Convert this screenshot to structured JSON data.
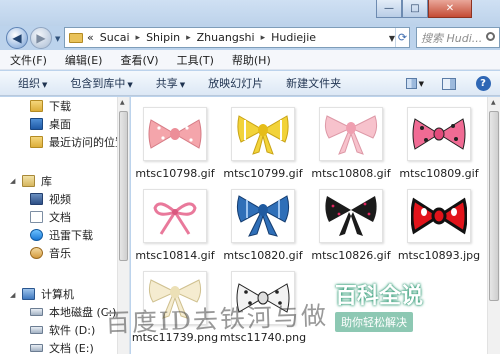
{
  "window": {
    "minimize_label": "—",
    "maximize_label": "□",
    "close_label": "✕"
  },
  "address": {
    "prefix": "«",
    "crumbs": [
      "Sucai",
      "Shipin",
      "Zhuangshi",
      "Hudiejie"
    ],
    "separator": "▸",
    "search_placeholder": "搜索 Hudi..."
  },
  "menu": [
    "文件(F)",
    "编辑(E)",
    "查看(V)",
    "工具(T)",
    "帮助(H)"
  ],
  "toolbar": {
    "organize": "组织",
    "include": "包含到库中",
    "share": "共享",
    "slideshow": "放映幻灯片",
    "new_folder": "新建文件夹"
  },
  "nav": {
    "downloads": "下载",
    "desktop": "桌面",
    "recent": "最近访问的位置",
    "library": "库",
    "videos": "视频",
    "documents": "文档",
    "thunder": "迅雷下载",
    "music": "音乐",
    "computer": "计算机",
    "disk_c": "本地磁盘 (C:)",
    "disk_d": "软件 (D:)",
    "disk_e": "文档 (E:)"
  },
  "files": [
    {
      "name": "mtsc10798.gif",
      "icon": "pink-polka-bow-icon",
      "color": "#f4a5ab"
    },
    {
      "name": "mtsc10799.gif",
      "icon": "yellow-gingham-bow-icon",
      "color": "#f2d33a"
    },
    {
      "name": "mtsc10808.gif",
      "icon": "light-pink-bow-icon",
      "color": "#f7c2cc"
    },
    {
      "name": "mtsc10809.gif",
      "icon": "pink-dotted-bow-icon",
      "color": "#f06b94"
    },
    {
      "name": "mtsc10814.gif",
      "icon": "pink-ribbon-bow-icon",
      "color": "#e9799b"
    },
    {
      "name": "mtsc10820.gif",
      "icon": "blue-plaid-bow-icon",
      "color": "#2f6fb8"
    },
    {
      "name": "mtsc10826.gif",
      "icon": "black-dotted-bow-icon",
      "color": "#1b1b1b"
    },
    {
      "name": "mtsc10893.jpg",
      "icon": "red-black-bow-icon",
      "color": "#e2141b"
    },
    {
      "name": "mtsc11739.png",
      "icon": "cream-bow-icon",
      "color": "#f5ecd0"
    },
    {
      "name": "mtsc11740.png",
      "icon": "white-dotted-bow-icon",
      "color": "#f2f2f2"
    }
  ],
  "watermark": {
    "left_text": "百度ID去铁河与做",
    "brand": "百科全说",
    "tagline": "助你轻松解决"
  }
}
